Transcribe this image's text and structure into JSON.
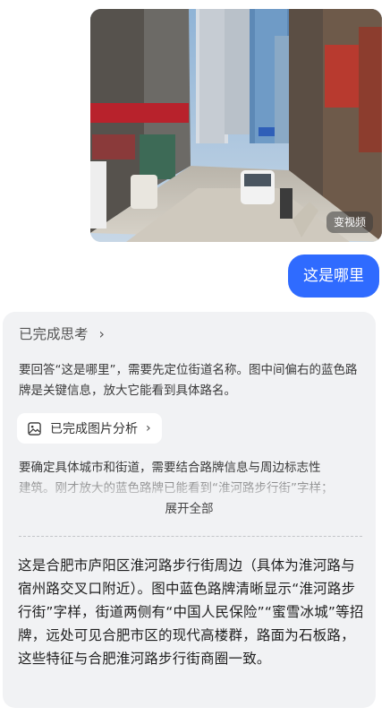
{
  "photo": {
    "video_label": "变视频"
  },
  "user_message": "这是哪里",
  "card": {
    "thinking_title": "已完成思考",
    "thinking_para1": "要回答“这是哪里”，需要先定位街道名称。图中间偏右的蓝色路牌是关键信息，放大它能看到具体路名。",
    "analysis_button": "已完成图片分析",
    "thinking_para2_line1": "要确定具体城市和街道，需要结合路牌信息与周边标志性",
    "thinking_para2_line2": "建筑。刚才放大的蓝色路牌已能看到“淮河路步行街”字样；",
    "expand_all": "展开全部",
    "answer": "这是合肥市庐阳区淮河路步行街周边（具体为淮河路与宿州路交叉口附近）。图中蓝色路牌清晰显示“淮河路步行街”字样，街道两侧有“中国人民保险”“蜜雪冰城”等招牌，远处可见合肥市区的现代高楼群，路面为石板路，这些特征与合肥淮河路步行街商圈一致。"
  },
  "colors": {
    "accent": "#2f6bff",
    "card_bg": "#f1f2f4"
  },
  "icons": {
    "thinking_chevron": "chevron-right-icon",
    "analysis_icon": "image-icon",
    "analysis_chevron": "chevron-right-icon"
  }
}
